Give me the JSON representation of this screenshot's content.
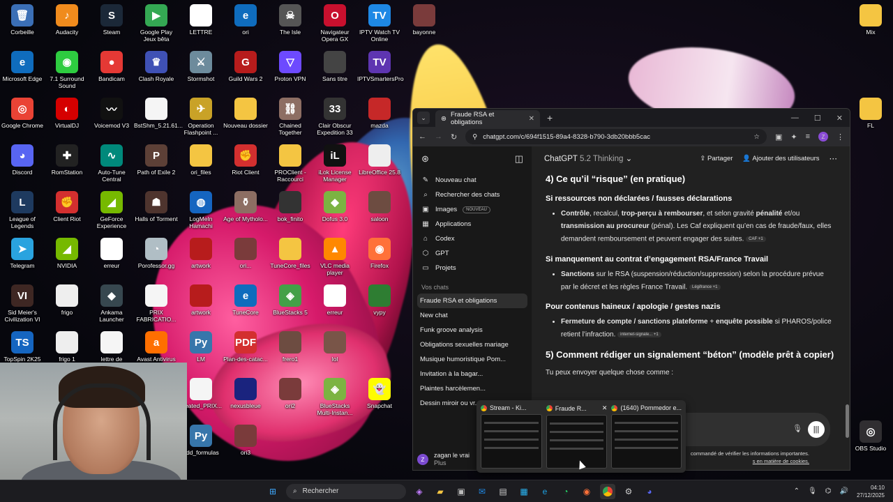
{
  "desktop": {
    "icons": [
      {
        "label": "Corbeille",
        "color": "#3b6fb6",
        "glyph": "🗑"
      },
      {
        "label": "Audacity",
        "color": "#f08b1d",
        "glyph": "♪"
      },
      {
        "label": "Steam",
        "color": "#1b2838",
        "glyph": "S"
      },
      {
        "label": "Google Play Jeux bêta",
        "color": "#34a853",
        "glyph": "▶"
      },
      {
        "label": "LETTRE",
        "color": "#ffffff",
        "glyph": ""
      },
      {
        "label": "ori",
        "color": "#0f6cbd",
        "glyph": "e"
      },
      {
        "label": "The Isle",
        "color": "#555555",
        "glyph": "☠"
      },
      {
        "label": "Navigateur Opera GX",
        "color": "#c8102e",
        "glyph": "O"
      },
      {
        "label": "IPTV Watch TV Online",
        "color": "#1e88e5",
        "glyph": "TV"
      },
      {
        "label": "bayonne",
        "color": "#7a3b3b",
        "glyph": ""
      },
      {
        "label": "Microsoft Edge",
        "color": "#0f6cbd",
        "glyph": "e"
      },
      {
        "label": "7.1 Surround Sound",
        "color": "#2ecc40",
        "glyph": "◉"
      },
      {
        "label": "Bandicam",
        "color": "#e53935",
        "glyph": "●"
      },
      {
        "label": "Clash Royale",
        "color": "#3f51b5",
        "glyph": "♛"
      },
      {
        "label": "Stormshot",
        "color": "#6d8b9c",
        "glyph": "⚔"
      },
      {
        "label": "Guild Wars 2",
        "color": "#b71c1c",
        "glyph": "G"
      },
      {
        "label": "Proton VPN",
        "color": "#6d4aff",
        "glyph": "▽"
      },
      {
        "label": "Sans titre",
        "color": "#444444",
        "glyph": ""
      },
      {
        "label": "IPTVSmartersPro",
        "color": "#5e35b1",
        "glyph": "TV"
      },
      {
        "label": "Google Chrome",
        "color": "#ea4335",
        "glyph": "◎"
      },
      {
        "label": "VirtualDJ",
        "color": "#d50000",
        "glyph": "◐"
      },
      {
        "label": "Voicemod V3",
        "color": "#111111",
        "glyph": "〰"
      },
      {
        "label": "BstShm_5.21.61...",
        "color": "#f5f5f5",
        "glyph": ""
      },
      {
        "label": "Operation Flashpoint ...",
        "color": "#c9a227",
        "glyph": "✈"
      },
      {
        "label": "Nouveau dossier",
        "color": "#f4c542",
        "glyph": ""
      },
      {
        "label": "Chained Together",
        "color": "#8d6e63",
        "glyph": "⛓"
      },
      {
        "label": "Clair Obscur Expedition 33",
        "color": "#333333",
        "glyph": "33"
      },
      {
        "label": "mazda",
        "color": "#c62828",
        "glyph": ""
      },
      {
        "label": "Discord",
        "color": "#5865f2",
        "glyph": "◕"
      },
      {
        "label": "RomStation",
        "color": "#222222",
        "glyph": "✚"
      },
      {
        "label": "Auto-Tune Central",
        "color": "#00897b",
        "glyph": "∿"
      },
      {
        "label": "Path of Exile 2",
        "color": "#5d4037",
        "glyph": "P"
      },
      {
        "label": "ori_files",
        "color": "#f4c542",
        "glyph": ""
      },
      {
        "label": "Riot Client",
        "color": "#d32f2f",
        "glyph": "✊"
      },
      {
        "label": "PROClient - Raccourci",
        "color": "#f4c542",
        "glyph": ""
      },
      {
        "label": "iLok License Manager",
        "color": "#111111",
        "glyph": "iL"
      },
      {
        "label": "LibreOffice 25.8",
        "color": "#eeeeee",
        "glyph": ""
      },
      {
        "label": "League of Legends",
        "color": "#1e3a5f",
        "glyph": "L"
      },
      {
        "label": "Client Riot",
        "color": "#d32f2f",
        "glyph": "✊"
      },
      {
        "label": "GeForce Experience",
        "color": "#76b900",
        "glyph": "◢"
      },
      {
        "label": "Halls of Torment",
        "color": "#4e342e",
        "glyph": "☗"
      },
      {
        "label": "LogMeIn Hamachi",
        "color": "#1565c0",
        "glyph": "◍"
      },
      {
        "label": "Age of Mytholo...",
        "color": "#8d6e63",
        "glyph": "⚱"
      },
      {
        "label": "bok_finito",
        "color": "#333333",
        "glyph": ""
      },
      {
        "label": "Dofus 3.0",
        "color": "#7cb342",
        "glyph": "◆"
      },
      {
        "label": "saloon",
        "color": "#6d4c41",
        "glyph": ""
      },
      {
        "label": "Telegram",
        "color": "#2aa3df",
        "glyph": "➤"
      },
      {
        "label": "NVIDIA",
        "color": "#76b900",
        "glyph": "◢"
      },
      {
        "label": "erreur",
        "color": "#ffffff",
        "glyph": ""
      },
      {
        "label": "Porofessor.gg",
        "color": "#b0bec5",
        "glyph": "◔"
      },
      {
        "label": "artwork",
        "color": "#b71c1c",
        "glyph": ""
      },
      {
        "label": "ori...",
        "color": "#7a3b3b",
        "glyph": ""
      },
      {
        "label": "TuneCore_files",
        "color": "#f4c542",
        "glyph": ""
      },
      {
        "label": "VLC media player",
        "color": "#ff8800",
        "glyph": "▲"
      },
      {
        "label": "Firefox",
        "color": "#ff7139",
        "glyph": "◉"
      },
      {
        "label": "Sid Meier's Civilization VI",
        "color": "#3e2723",
        "glyph": "VI"
      },
      {
        "label": "frigo",
        "color": "#eeeeee",
        "glyph": ""
      },
      {
        "label": "Ankama Launcher",
        "color": "#37474f",
        "glyph": "◆"
      },
      {
        "label": "PRIX FABRICATIO...",
        "color": "#f5f5f5",
        "glyph": ""
      },
      {
        "label": "artwork",
        "color": "#b71c1c",
        "glyph": ""
      },
      {
        "label": "TuneCore",
        "color": "#0f6cbd",
        "glyph": "e"
      },
      {
        "label": "BlueStacks 5",
        "color": "#43a047",
        "glyph": "◈"
      },
      {
        "label": "erreur",
        "color": "#ffffff",
        "glyph": ""
      },
      {
        "label": "vypy",
        "color": "#2e7d32",
        "glyph": ""
      },
      {
        "label": "TopSpin 2K25",
        "color": "#1565c0",
        "glyph": "TS"
      },
      {
        "label": "frigo 1",
        "color": "#eeeeee",
        "glyph": ""
      },
      {
        "label": "lettre de",
        "color": "#f5f5f5",
        "glyph": ""
      },
      {
        "label": "Avast Antivirus",
        "color": "#ff6f00",
        "glyph": "a"
      },
      {
        "label": "LM",
        "color": "#3776ab",
        "glyph": "Py"
      },
      {
        "label": "Plan-des-catac...",
        "color": "#d32f2f",
        "glyph": "PDF"
      },
      {
        "label": "frero1",
        "color": "#6d4c41",
        "glyph": ""
      },
      {
        "label": "lol",
        "color": "#795548",
        "glyph": ""
      },
      {
        "label": "created_PRIX...",
        "color": "#f5f5f5",
        "glyph": ""
      },
      {
        "label": "nexusbleue",
        "color": "#1a237e",
        "glyph": ""
      },
      {
        "label": "ori2",
        "color": "#7a3b3b",
        "glyph": ""
      },
      {
        "label": "BlueStacks Multi-Instan...",
        "color": "#7cb342",
        "glyph": "◈"
      },
      {
        "label": "Snapchat",
        "color": "#fffc00",
        "glyph": "👻"
      },
      {
        "label": "add_formulas",
        "color": "#3776ab",
        "glyph": "Py"
      },
      {
        "label": "ori3",
        "color": "#7a3b3b",
        "glyph": ""
      },
      {
        "label": "Mix",
        "color": "#f4c542",
        "glyph": ""
      },
      {
        "label": "FL",
        "color": "#f4c542",
        "glyph": ""
      },
      {
        "label": "OBS Studio",
        "color": "#302e31",
        "glyph": "◎"
      }
    ]
  },
  "browser": {
    "tab_title": "Fraude RSA et obligations",
    "url": "chatgpt.com/c/694f1515-89a4-8328-b790-3db20bbb5cac",
    "profile_initial": "Z"
  },
  "chatgpt": {
    "model": "ChatGPT",
    "model_sub": "5.2 Thinking",
    "share": "Partager",
    "add_users": "Ajouter des utilisateurs",
    "nav": [
      {
        "label": "Nouveau chat",
        "icon": "✎"
      },
      {
        "label": "Rechercher des chats",
        "icon": "⌕"
      },
      {
        "label": "Images",
        "icon": "▣",
        "badge": "NOUVEAU"
      },
      {
        "label": "Applications",
        "icon": "▦"
      },
      {
        "label": "Codex",
        "icon": "⌂"
      },
      {
        "label": "GPT",
        "icon": "⬡"
      },
      {
        "label": "Projets",
        "icon": "▭"
      }
    ],
    "section_label": "Vos chats",
    "chats": [
      "Fraude RSA et obligations",
      "New chat",
      "Funk groove analysis",
      "Obligations sexuelles mariage",
      "Musique humoristique Pom...",
      "Invitation à la bagar...",
      "Plaintes harcèlemen...",
      "Dessin miroir ou vr..."
    ],
    "user_name": "zagan le vrai",
    "user_plan": "Plus",
    "user_initial": "Z",
    "content": {
      "h3_risk": "4) Ce qu’il “risque” (en pratique)",
      "h4_undeclared": "Si ressources non déclarées / fausses déclarations",
      "li1_b1": "Contrôle",
      "li1_t1": ", recalcul, ",
      "li1_b2": "trop-perçu à rembourser",
      "li1_t2": ", et selon gravité ",
      "li1_b3": "pénalité",
      "li1_t3": " et/ou ",
      "li1_b4": "transmission au procureur",
      "li1_t4": " (pénal). Les Caf expliquent qu’en cas de fraude/faux, elles demandent remboursement et peuvent engager des suites.",
      "li1_src": "CAF +1",
      "h4_engagement": "Si manquement au contrat d’engagement RSA/France Travail",
      "li2_b1": "Sanctions",
      "li2_t1": " sur le RSA (suspension/réduction/suppression) selon la procédure prévue par le décret et les règles France Travail.",
      "li2_src": "Légifrance +1",
      "h4_hate": "Pour contenus haineux / apologie / gestes nazis",
      "li3_b1": "Fermeture de compte / sanctions plateforme",
      "li3_t1": " + ",
      "li3_b2": "enquête possible",
      "li3_t2": " si PHAROS/police retient l’infraction.",
      "li3_src": "internet-signale... +1",
      "h3_report": "5) Comment rédiger un signalement “béton” (modèle prêt à copier)",
      "intro": "Tu peux envoyer quelque chose comme :"
    },
    "disclaimer_1": "commandé de vérifier les informations importantes.",
    "disclaimer_2": "s en matière de cookies."
  },
  "previews": [
    {
      "title": "Stream - Ki..."
    },
    {
      "title": "Fraude R..."
    },
    {
      "title": "(1640) Pommedor e..."
    }
  ],
  "taskbar": {
    "search_placeholder": "Rechercher",
    "time": "04:10",
    "date": "27/12/2025"
  }
}
